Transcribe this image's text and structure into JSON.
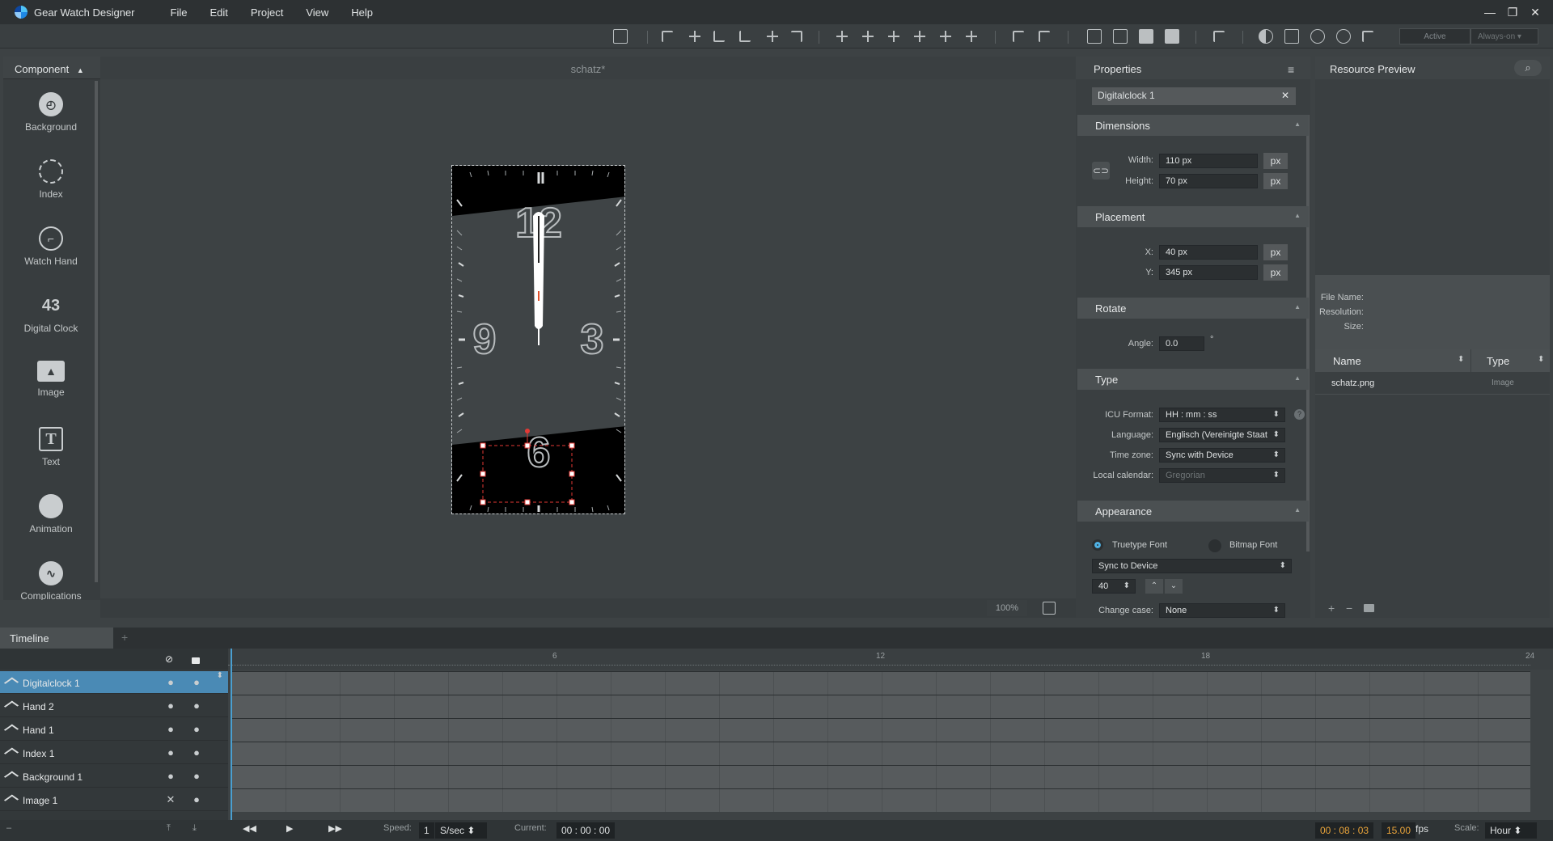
{
  "app": {
    "title": "Gear Watch Designer",
    "menu": [
      "File",
      "Edit",
      "Project",
      "View",
      "Help"
    ]
  },
  "toolbar": {
    "mode_active": "Active",
    "mode_aod": "Always-on"
  },
  "component_panel": {
    "title": "Component",
    "items": [
      {
        "label": "Background",
        "icon": "clock-icon"
      },
      {
        "label": "Index",
        "icon": "dashed-circle-icon"
      },
      {
        "label": "Watch Hand",
        "icon": "clock-outline-icon"
      },
      {
        "label": "Digital Clock",
        "icon": "digits-icon"
      },
      {
        "label": "Image",
        "icon": "image-icon"
      },
      {
        "label": "Text",
        "icon": "text-icon"
      },
      {
        "label": "Animation",
        "icon": "animation-icon"
      },
      {
        "label": "Complications",
        "icon": "pulse-icon"
      }
    ]
  },
  "canvas": {
    "tab_title": "schatz*",
    "zoom": "100%",
    "watch": {
      "n12": "12",
      "n3": "3",
      "n6": "6",
      "n9": "9"
    }
  },
  "properties": {
    "title": "Properties",
    "selected": "Digitalclock 1",
    "dimensions": {
      "title": "Dimensions",
      "width_label": "Width:",
      "width": "110 px",
      "height_label": "Height:",
      "height": "70 px",
      "unit": "px"
    },
    "placement": {
      "title": "Placement",
      "x_label": "X:",
      "x": "40 px",
      "y_label": "Y:",
      "y": "345 px",
      "unit": "px"
    },
    "rotate": {
      "title": "Rotate",
      "angle_label": "Angle:",
      "angle": "0.0",
      "deg": "°"
    },
    "type": {
      "title": "Type",
      "icu_label": "ICU Format:",
      "icu": "HH : mm : ss",
      "lang_label": "Language:",
      "lang": "Englisch (Vereinigte Staat",
      "tz_label": "Time zone:",
      "tz": "Sync with Device",
      "cal_label": "Local calendar:",
      "cal": "Gregorian"
    },
    "appearance": {
      "title": "Appearance",
      "truetype": "Truetype Font",
      "bitmap": "Bitmap Font",
      "font": "Sync to Device",
      "size": "40",
      "case_label": "Change case:",
      "case": "None"
    }
  },
  "resource": {
    "title": "Resource Preview",
    "file_name_label": "File Name:",
    "resolution_label": "Resolution:",
    "size_label": "Size:",
    "col_name": "Name",
    "col_type": "Type",
    "rows": [
      {
        "name": "schatz.png",
        "type": "Image"
      }
    ]
  },
  "timeline": {
    "tab": "Timeline",
    "add": "+",
    "ruler": [
      "6",
      "12",
      "18",
      "24"
    ],
    "layers": [
      {
        "name": "Digitalclock 1",
        "vis": "●",
        "lock": "●"
      },
      {
        "name": "Hand 2",
        "vis": "●",
        "lock": "●"
      },
      {
        "name": "Hand 1",
        "vis": "●",
        "lock": "●"
      },
      {
        "name": "Index 1",
        "vis": "●",
        "lock": "●"
      },
      {
        "name": "Background 1",
        "vis": "●",
        "lock": "●"
      },
      {
        "name": "Image 1",
        "vis": "✕",
        "lock": "●"
      }
    ],
    "speed_label": "Speed:",
    "speed": "1",
    "speed_unit": "S/sec",
    "current_label": "Current:",
    "current": "00 : 00 : 00",
    "clock": "00 : 08 : 03",
    "fps_value": "15.00",
    "fps": "fps",
    "scale_label": "Scale:",
    "scale": "Hour"
  }
}
